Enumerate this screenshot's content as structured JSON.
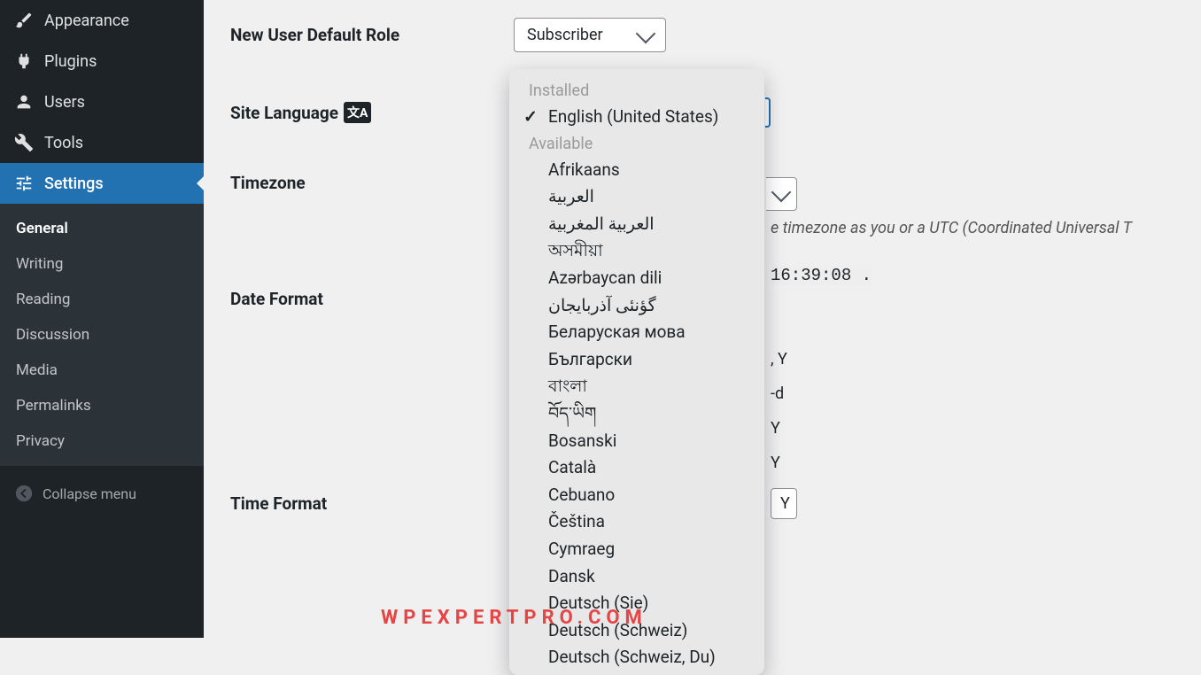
{
  "sidebar": {
    "appearance": "Appearance",
    "plugins": "Plugins",
    "users": "Users",
    "tools": "Tools",
    "settings": "Settings",
    "submenu": {
      "general": "General",
      "writing": "Writing",
      "reading": "Reading",
      "discussion": "Discussion",
      "media": "Media",
      "permalinks": "Permalinks",
      "privacy": "Privacy"
    },
    "collapse": "Collapse menu"
  },
  "form": {
    "default_role_label": "New User Default Role",
    "default_role_value": "Subscriber",
    "site_language_label": "Site Language",
    "timezone_label": "Timezone",
    "timezone_help": "e timezone as you or a UTC (Coordinated Universal T",
    "utc_time": "16:39:08 .",
    "date_format_label": "Date Format",
    "date_fmt_1": ", Y",
    "date_fmt_2": "-d",
    "date_fmt_3": "Y",
    "date_fmt_4": "Y",
    "date_fmt_input": "Y",
    "time_format_label": "Time Format"
  },
  "dropdown": {
    "installed_header": "Installed",
    "selected": "English (United States)",
    "available_header": "Available",
    "items": [
      "Afrikaans",
      "العربية",
      "العربية المغربية",
      "অসমীয়া",
      "Azərbaycan dili",
      "گؤنئی آذربایجان",
      "Беларуская мова",
      "Български",
      "বাংলা",
      "བོད་ཡིག",
      "Bosanski",
      "Català",
      "Cebuano",
      "Čeština",
      "Cymraeg",
      "Dansk",
      "Deutsch (Sie)",
      "Deutsch (Schweiz)",
      "Deutsch (Schweiz, Du)"
    ]
  },
  "watermark": "WPEXPERTPRO.COM"
}
